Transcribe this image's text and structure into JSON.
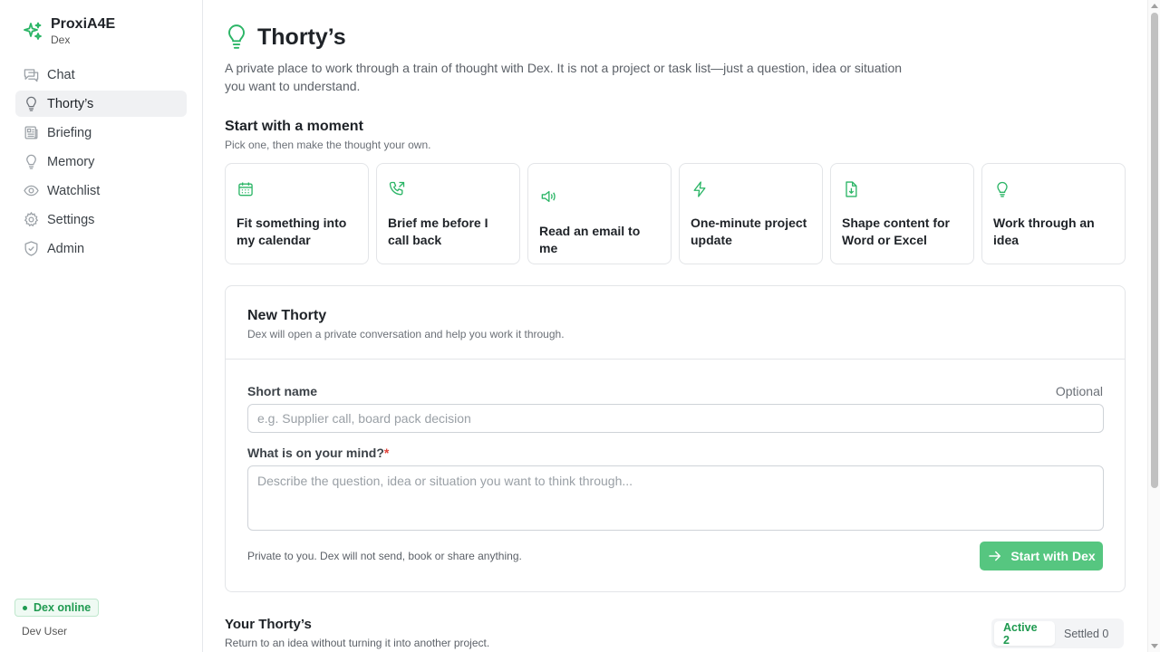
{
  "app": {
    "name": "ProxiA4E",
    "subtitle": "Dex",
    "icon": "sparkles-icon"
  },
  "sidebar": {
    "items": [
      {
        "label": "Chat",
        "icon": "chat-icon",
        "active": false
      },
      {
        "label": "Thorty’s",
        "icon": "lightbulb-icon",
        "active": true
      },
      {
        "label": "Briefing",
        "icon": "newspaper-icon",
        "active": false
      },
      {
        "label": "Memory",
        "icon": "lightbulb-icon",
        "active": false
      },
      {
        "label": "Watchlist",
        "icon": "eye-icon",
        "active": false
      },
      {
        "label": "Settings",
        "icon": "gear-icon",
        "active": false
      },
      {
        "label": "Admin",
        "icon": "shield-check-icon",
        "active": false
      }
    ],
    "status": "Dex online",
    "user": "Dev User"
  },
  "page": {
    "title": "Thorty’s",
    "description": "A private place to work through a train of thought with Dex. It is not a project or task list—just a question, idea or situation you want to understand."
  },
  "moments": {
    "title": "Start with a moment",
    "subtitle": "Pick one, then make the thought your own.",
    "cards": [
      {
        "label": "Fit something into my calendar",
        "icon": "calendar-icon"
      },
      {
        "label": "Brief me before I call back",
        "icon": "phone-outgoing-icon"
      },
      {
        "label": "Read an email to me",
        "icon": "speaker-icon"
      },
      {
        "label": "One-minute project update",
        "icon": "lightning-icon"
      },
      {
        "label": "Shape content for Word or Excel",
        "icon": "file-download-icon"
      },
      {
        "label": "Work through an idea",
        "icon": "lightbulb-icon"
      }
    ]
  },
  "new_thorty": {
    "title": "New Thorty",
    "subtitle": "Dex will open a private conversation and help you work it through.",
    "short_name_label": "Short name",
    "short_name_optional": "Optional",
    "short_name_placeholder": "e.g. Supplier call, board pack decision",
    "short_name_value": "",
    "mind_label": "What is on your mind?",
    "mind_required": "*",
    "mind_placeholder": "Describe the question, idea or situation you want to think through...",
    "mind_value": "",
    "footer_note": "Private to you. Dex will not send, book or share anything.",
    "start_button": "Start with Dex"
  },
  "your_thortys": {
    "title": "Your Thorty’s",
    "subtitle": "Return to an idea without turning it into another project.",
    "tabs": [
      {
        "label": "Active 2",
        "active": true
      },
      {
        "label": "Settled 0",
        "active": false
      }
    ]
  },
  "colors": {
    "accent": "#1f9a50",
    "button": "#56c680",
    "icon_green": "#2bb566"
  }
}
